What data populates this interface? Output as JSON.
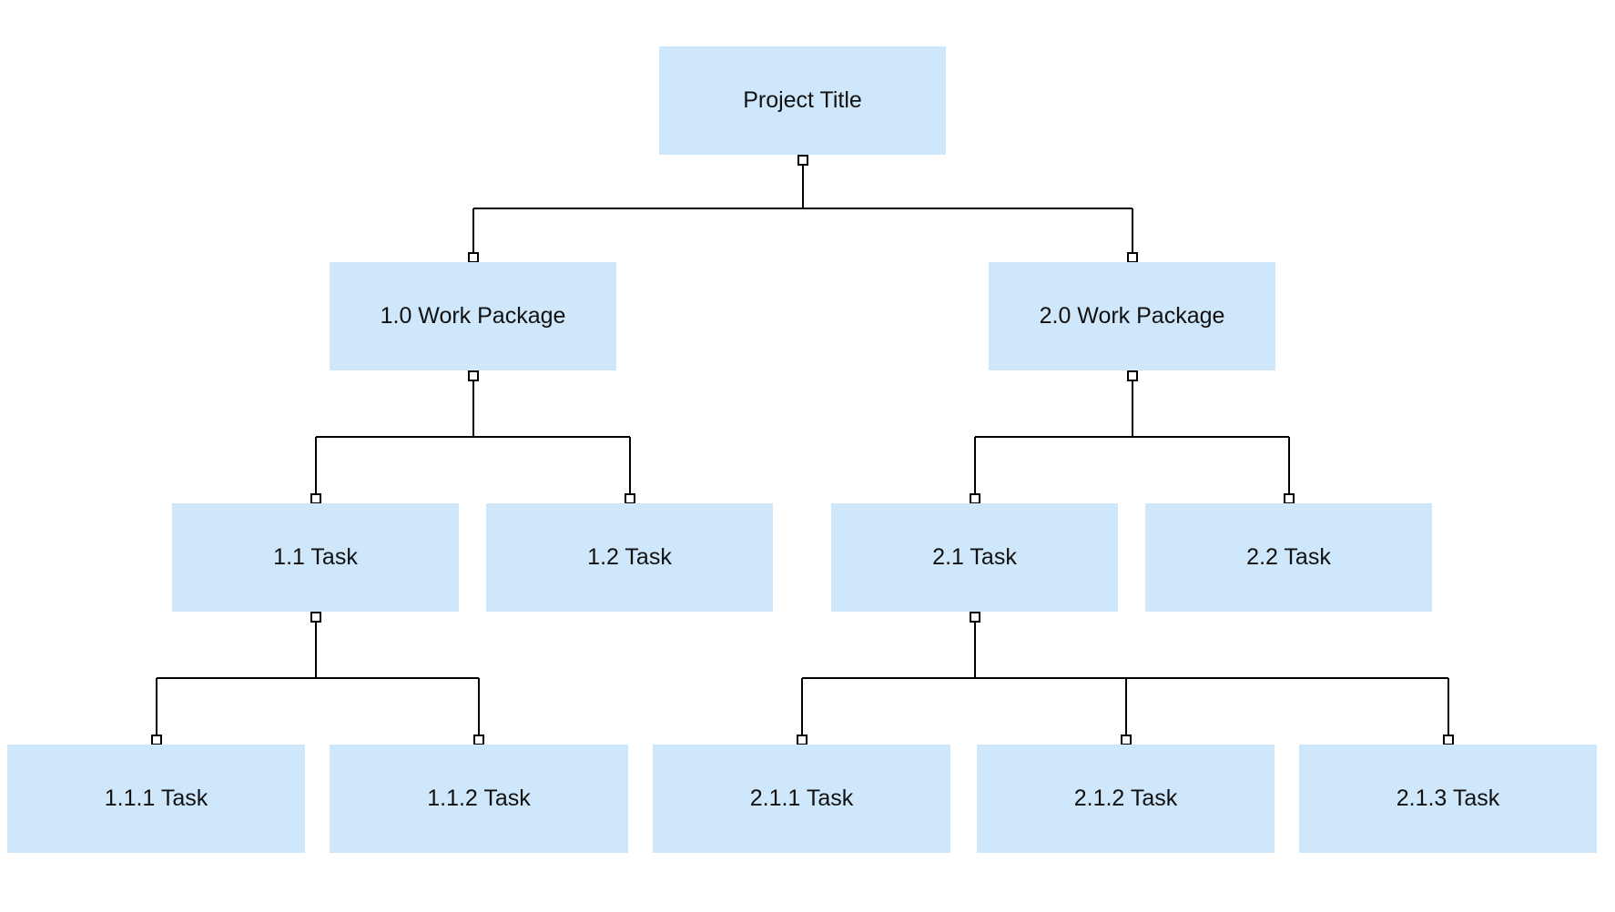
{
  "diagram": {
    "type": "work-breakdown-structure",
    "colors": {
      "node_fill": "#CFE7FA",
      "node_text": "#111111",
      "connector": "#000000",
      "port_fill": "#FFFFFF"
    },
    "nodes": [
      {
        "id": "root",
        "label": "Project Title",
        "parent": null,
        "level": 0
      },
      {
        "id": "wp1",
        "label": "1.0 Work Package",
        "parent": "root",
        "level": 1
      },
      {
        "id": "wp2",
        "label": "2.0 Work Package",
        "parent": "root",
        "level": 1
      },
      {
        "id": "t11",
        "label": "1.1 Task",
        "parent": "wp1",
        "level": 2
      },
      {
        "id": "t12",
        "label": "1.2 Task",
        "parent": "wp1",
        "level": 2
      },
      {
        "id": "t21",
        "label": "2.1 Task",
        "parent": "wp2",
        "level": 2
      },
      {
        "id": "t22",
        "label": "2.2 Task",
        "parent": "wp2",
        "level": 2
      },
      {
        "id": "t111",
        "label": "1.1.1 Task",
        "parent": "t11",
        "level": 3
      },
      {
        "id": "t112",
        "label": "1.1.2 Task",
        "parent": "t11",
        "level": 3
      },
      {
        "id": "t211",
        "label": "2.1.1 Task",
        "parent": "t21",
        "level": 3
      },
      {
        "id": "t212",
        "label": "2.1.2 Task",
        "parent": "t21",
        "level": 3
      },
      {
        "id": "t213",
        "label": "2.1.3 Task",
        "parent": "t21",
        "level": 3
      }
    ]
  }
}
